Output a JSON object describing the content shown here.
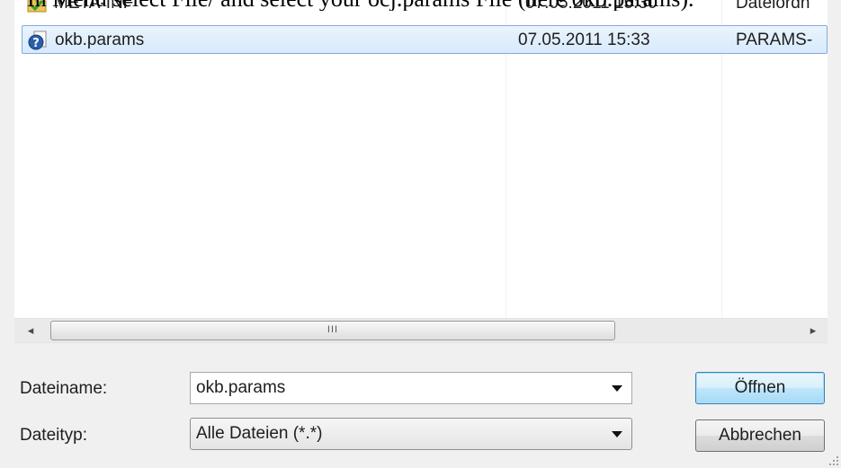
{
  "caption": "In Menu select File/ and select your ocj.params File (here okb.params).",
  "files": [
    {
      "name": "META-INF",
      "date": "07.05.2011 15:30",
      "type": "Dateiordn",
      "icon": "folder-icon"
    },
    {
      "name": "okb.params",
      "date": "07.05.2011 15:33",
      "type": "PARAMS-",
      "icon": "unknown-file-icon",
      "selected": true
    }
  ],
  "scrollbar": {
    "left_arrow": "◂",
    "right_arrow": "▸",
    "grip": "III"
  },
  "filename": {
    "label": "Dateiname:",
    "value": "okb.params"
  },
  "filetype": {
    "label": "Dateityp:",
    "value": "Alle Dateien (*.*)"
  },
  "buttons": {
    "open": "Öffnen",
    "cancel": "Abbrechen"
  }
}
